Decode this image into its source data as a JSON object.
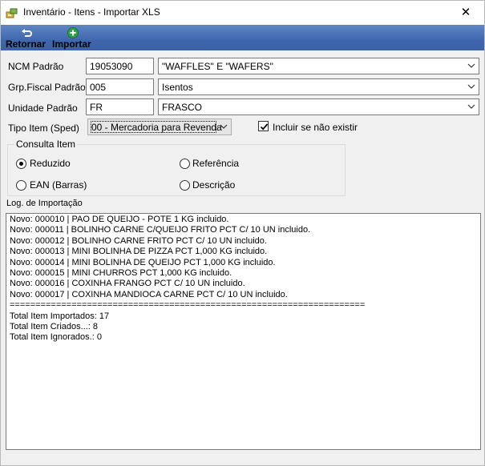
{
  "window": {
    "title": "Inventário - Itens - Importar XLS",
    "close_glyph": "✕"
  },
  "toolbar": {
    "retornar_label": "Retornar",
    "importar_label": "Importar"
  },
  "form": {
    "ncm": {
      "label": "NCM Padrão",
      "code": "19053090",
      "description": "\"WAFFLES\" E \"WAFERS\""
    },
    "grp_fiscal": {
      "label": "Grp.Fiscal Padrão",
      "code": "005",
      "description": "Isentos"
    },
    "unidade": {
      "label": "Unidade Padrão",
      "code": "FR",
      "description": "FRASCO"
    },
    "tipo_item": {
      "label": "Tipo Item (Sped)",
      "value": "00 - Mercadoria para Revenda"
    },
    "incluir": {
      "label": "Incluir se não existir",
      "checked": true
    }
  },
  "consulta": {
    "legend": "Consulta Item",
    "options": [
      {
        "label": "Reduzido",
        "checked": true
      },
      {
        "label": "Referência",
        "checked": false
      },
      {
        "label": "EAN (Barras)",
        "checked": false
      },
      {
        "label": "Descrição",
        "checked": false
      }
    ]
  },
  "log": {
    "label": "Log. de Importação",
    "lines": [
      "Novo: 000010 | PAO DE QUEIJO - POTE 1 KG incluido.",
      "Novo: 000011 | BOLINHO CARNE C/QUEIJO FRITO PCT C/ 10 UN incluido.",
      "Novo: 000012 | BOLINHO CARNE FRITO PCT C/ 10 UN incluido.",
      "Novo: 000013 | MINI BOLINHA DE PIZZA PCT 1,000 KG incluido.",
      "Novo: 000014 | MINI BOLINHA DE QUEIJO PCT 1,000 KG incluido.",
      "Novo: 000015 | MINI CHURROS PCT 1,000 KG incluido.",
      "Novo: 000016 | COXINHA FRANGO PCT C/ 10 UN incluido.",
      "Novo: 000017 | COXINHA MANDIOCA CARNE PCT C/ 10 UN incluido.",
      "=====================================================================",
      "Total Item Importados: 17",
      "Total Item Criados...: 8",
      "Total Item Ignorados.: 0"
    ]
  },
  "colors": {
    "toolbar": "#3f67ad",
    "panel": "#f0f0f0"
  }
}
